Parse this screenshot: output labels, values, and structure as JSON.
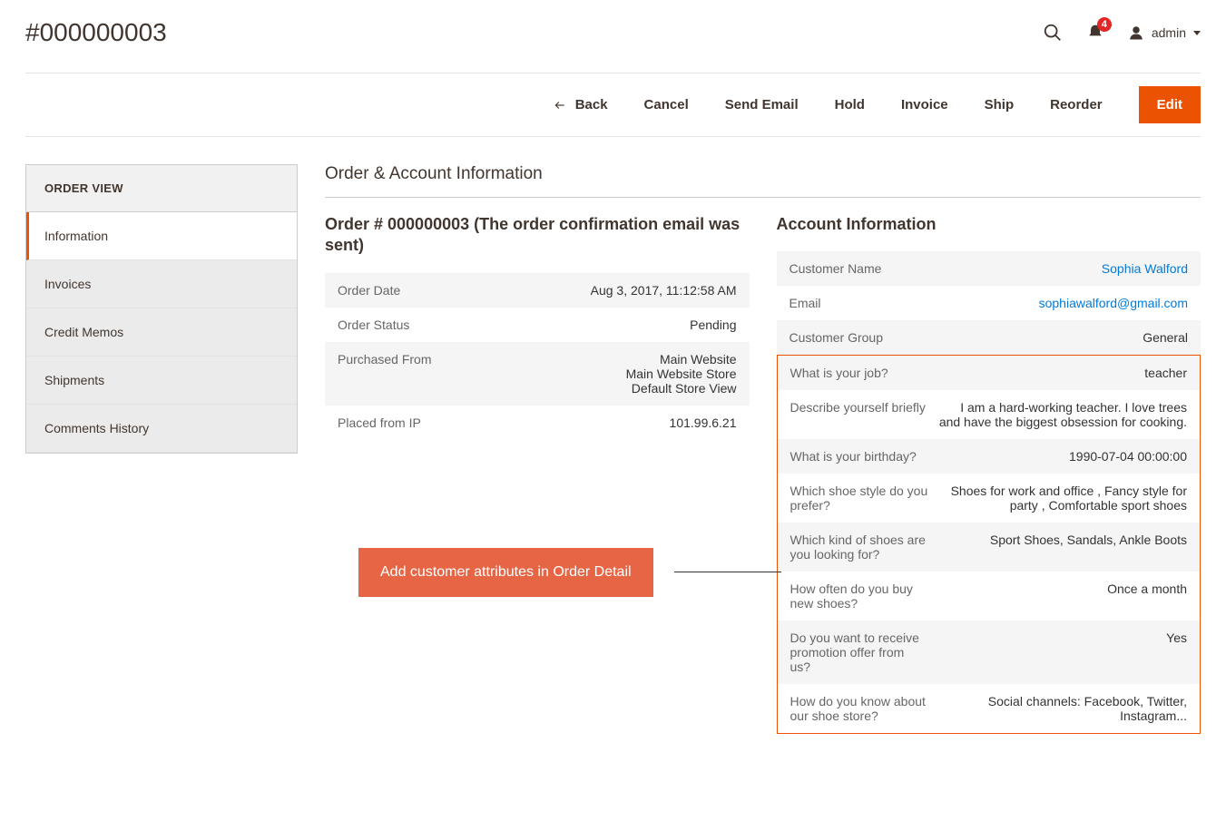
{
  "header": {
    "title": "#000000003",
    "notification_count": "4",
    "username": "admin"
  },
  "actions": {
    "back": "Back",
    "cancel": "Cancel",
    "send_email": "Send Email",
    "hold": "Hold",
    "invoice": "Invoice",
    "ship": "Ship",
    "reorder": "Reorder",
    "edit": "Edit"
  },
  "sidebar": {
    "title": "ORDER VIEW",
    "items": [
      "Information",
      "Invoices",
      "Credit Memos",
      "Shipments",
      "Comments History"
    ]
  },
  "section_title": "Order & Account Information",
  "order": {
    "heading": "Order # 000000003 (The order confirmation email was sent)",
    "rows": [
      {
        "label": "Order Date",
        "value": "Aug 3, 2017, 11:12:58 AM"
      },
      {
        "label": "Order Status",
        "value": "Pending"
      },
      {
        "label": "Purchased From",
        "value": "Main Website\nMain Website Store\nDefault Store View"
      },
      {
        "label": "Placed from IP",
        "value": "101.99.6.21"
      }
    ]
  },
  "account": {
    "heading": "Account Information",
    "base_rows": [
      {
        "label": "Customer Name",
        "value": "Sophia Walford",
        "link": true
      },
      {
        "label": "Email",
        "value": "sophiawalford@gmail.com",
        "link": true
      },
      {
        "label": "Customer Group",
        "value": "General"
      }
    ],
    "attr_rows": [
      {
        "label": "What is your job?",
        "value": "teacher"
      },
      {
        "label": "Describe yourself briefly",
        "value": "I am a hard-working teacher. I love trees and have the biggest obsession for cooking."
      },
      {
        "label": "What is your birthday?",
        "value": "1990-07-04 00:00:00"
      },
      {
        "label": "Which shoe style do you prefer?",
        "value": "Shoes for work and office , Fancy style for party , Comfortable sport shoes"
      },
      {
        "label": "Which kind of shoes are you looking for?",
        "value": "Sport Shoes, Sandals, Ankle Boots"
      },
      {
        "label": "How often do you buy new shoes?",
        "value": "Once a month"
      },
      {
        "label": "Do you want to receive promotion offer from us?",
        "value": "Yes"
      },
      {
        "label": "How do you know about our shoe store?",
        "value": "Social channels: Facebook, Twitter, Instagram..."
      }
    ]
  },
  "callout": "Add customer attributes in Order Detail"
}
